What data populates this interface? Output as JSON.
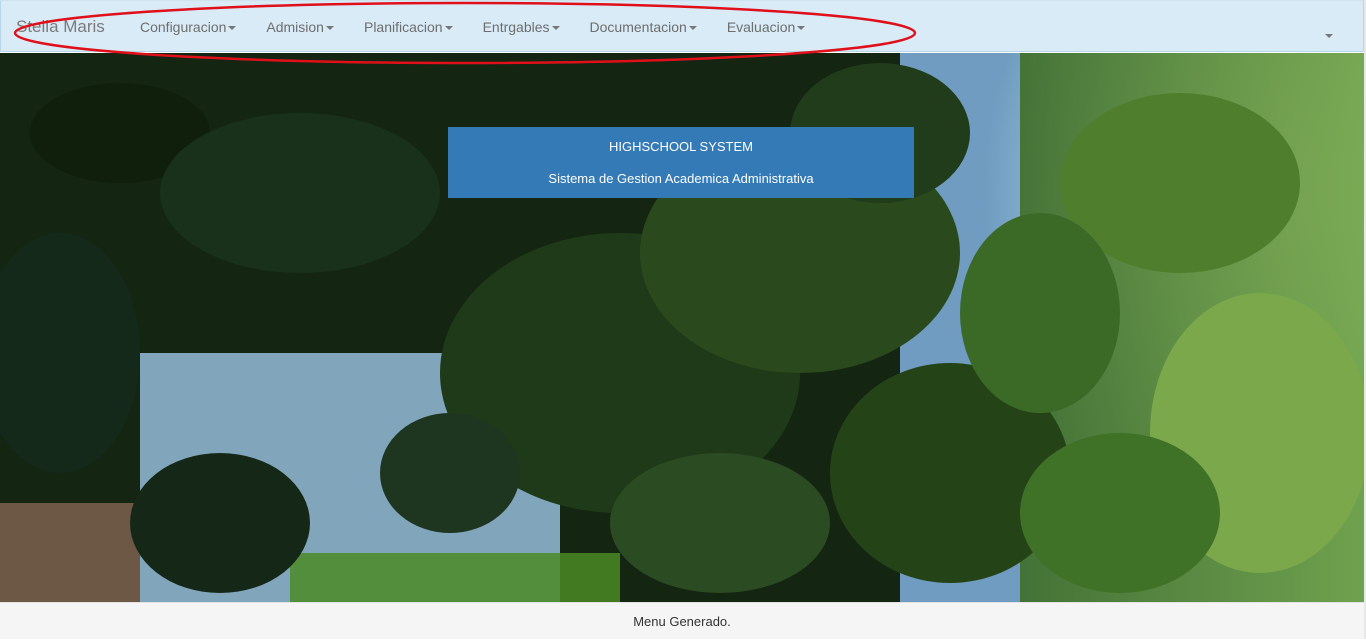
{
  "navbar": {
    "brand": "Stella Maris",
    "items": [
      {
        "label": "Configuracion"
      },
      {
        "label": "Admision"
      },
      {
        "label": "Planificacion"
      },
      {
        "label": "Entrgables"
      },
      {
        "label": "Documentacion"
      },
      {
        "label": "Evaluacion"
      }
    ]
  },
  "banner": {
    "title": "HIGHSCHOOL SYSTEM",
    "subtitle": "Sistema de Gestion Academica Administrativa",
    "color": "#337ab7"
  },
  "footer": {
    "text": "Menu Generado."
  },
  "colors": {
    "navbar_bg": "#d8ebf7",
    "annotation": "#e0101a"
  },
  "icons": {
    "dropdown": "caret-down-icon"
  }
}
